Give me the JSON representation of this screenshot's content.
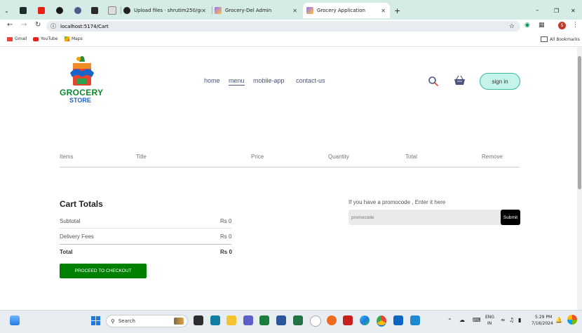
{
  "browser": {
    "tabs": [
      {
        "label": "",
        "icon": "dropdown-icon"
      },
      {
        "label": "",
        "icon": "app-icon"
      },
      {
        "label": "",
        "icon": "youtube-icon"
      },
      {
        "label": "",
        "icon": "app-icon"
      },
      {
        "label": "",
        "icon": "app-icon"
      },
      {
        "label": "",
        "icon": "app-icon"
      },
      {
        "label": "",
        "icon": "app-icon"
      },
      {
        "label": "Upload files · shrutim250/groc",
        "icon": "github-icon"
      },
      {
        "label": "Grocery-Del Admin",
        "icon": "vite-icon"
      },
      {
        "label": "Grocery Application",
        "icon": "vite-icon"
      }
    ],
    "url": "localhost:5174/Cart",
    "bookmarks": [
      "Gmail",
      "YouTube",
      "Maps"
    ],
    "all_bookmarks": "All Bookmarks",
    "profile_initial": "S"
  },
  "header": {
    "logo_line1": "GROCERY",
    "logo_line2": "STORE",
    "nav": [
      "home",
      "menu",
      "mobile-app",
      "contact-us"
    ],
    "active_nav": "menu",
    "signin_label": "sign in"
  },
  "cart": {
    "columns": [
      "Items",
      "Title",
      "Price",
      "Quantity",
      "Total",
      "Remove"
    ]
  },
  "totals": {
    "title": "Cart Totals",
    "rows": [
      {
        "label": "Subtotal",
        "value": "Rs 0"
      },
      {
        "label": "Delivery Fees",
        "value": "Rs 0"
      },
      {
        "label": "Total",
        "value": "Rs 0"
      }
    ],
    "checkout_label": "PROCEED TO CHECKOUT"
  },
  "promo": {
    "text": "If you have a promocode , Enter it here",
    "placeholder": "promocode",
    "submit_label": "Submit"
  },
  "taskbar": {
    "search_placeholder": "Search",
    "lang_line1": "ENG",
    "lang_line2": "IN",
    "time": "5:29 PM",
    "date": "7/16/2024"
  },
  "colors": {
    "accent_green": "#008000",
    "signin_bg": "#c5f5ea",
    "nav_text": "#49557e"
  }
}
